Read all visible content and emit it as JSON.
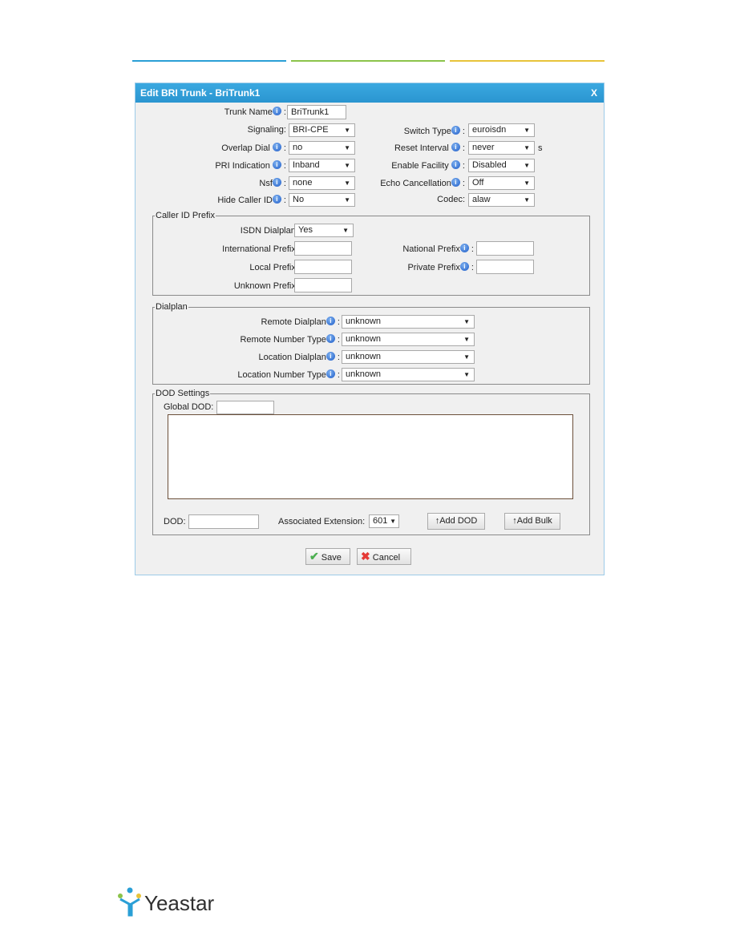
{
  "colors": {
    "header": "#2f9fd8",
    "line_blue": "#2a9fd6",
    "line_green": "#8bc34a",
    "line_yellow": "#e8c33a"
  },
  "dialog": {
    "title": "Edit BRI Trunk - BriTrunk1",
    "close": "X"
  },
  "general": {
    "trunk_name": {
      "label": "Trunk Name",
      "value": "BriTrunk1"
    },
    "signaling": {
      "label": "Signaling:",
      "value": "BRI-CPE"
    },
    "switch_type": {
      "label": "Switch Type",
      "value": "euroisdn"
    },
    "overlap_dial": {
      "label": "Overlap Dial",
      "value": "no"
    },
    "reset_interval": {
      "label": "Reset Interval",
      "value": "never",
      "unit": "s"
    },
    "pri_indication": {
      "label": "PRI Indication",
      "value": "Inband"
    },
    "enable_facility": {
      "label": "Enable Facility",
      "value": "Disabled"
    },
    "nsf": {
      "label": "Nsf",
      "value": "none"
    },
    "echo_cancellation": {
      "label": "Echo Cancellation",
      "value": "Off"
    },
    "hide_caller_id": {
      "label": "Hide Caller ID",
      "value": "No"
    },
    "codec": {
      "label": "Codec:",
      "value": "alaw"
    }
  },
  "caller_id_prefix": {
    "legend": "Caller ID Prefix",
    "isdn_dialplan": {
      "label": "ISDN Dialplan",
      "value": "Yes"
    },
    "international": {
      "label": "International Prefix",
      "value": ""
    },
    "national": {
      "label": "National Prefix",
      "value": ""
    },
    "local": {
      "label": "Local Prefix",
      "value": ""
    },
    "private": {
      "label": "Private Prefix",
      "value": ""
    },
    "unknown": {
      "label": "Unknown Prefix",
      "value": ""
    }
  },
  "dialplan": {
    "legend": "Dialplan",
    "rows": [
      {
        "label": "Remote Dialplan",
        "value": "unknown"
      },
      {
        "label": "Remote Number Type",
        "value": "unknown"
      },
      {
        "label": "Location Dialplan",
        "value": "unknown"
      },
      {
        "label": "Location Number Type",
        "value": "unknown"
      }
    ]
  },
  "dod": {
    "legend": "DOD Settings",
    "global_label": "Global DOD:",
    "global_value": "",
    "dod_label": "DOD:",
    "dod_value": "",
    "ext_label": "Associated Extension:",
    "ext_value": "601",
    "add_dod": "↑Add DOD",
    "add_bulk": "↑Add Bulk"
  },
  "footer": {
    "save": "Save",
    "cancel": "Cancel"
  },
  "logo": {
    "text": "Yeastar"
  }
}
